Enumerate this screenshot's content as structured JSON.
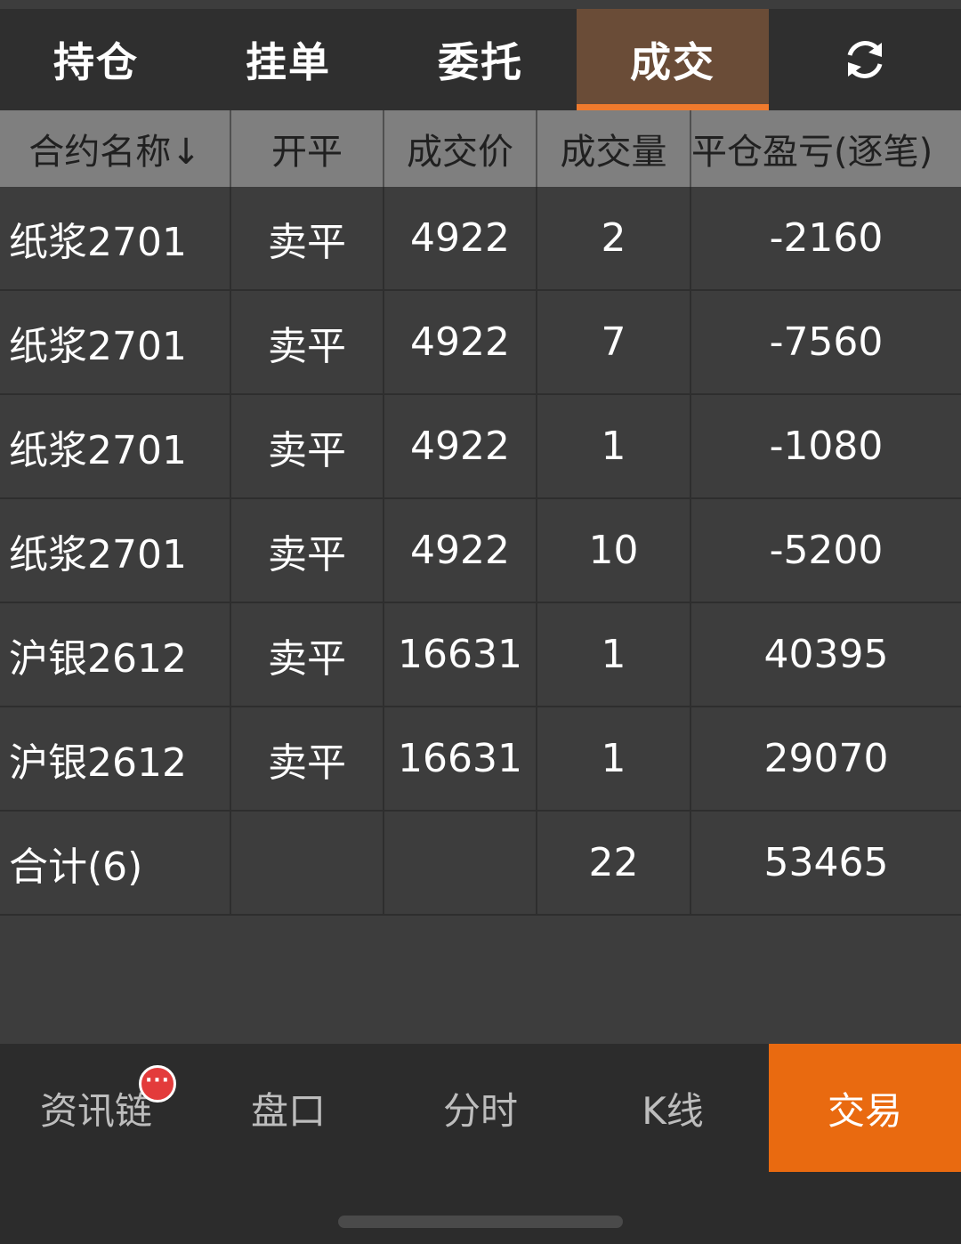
{
  "tabs": [
    {
      "label": "持仓"
    },
    {
      "label": "挂单"
    },
    {
      "label": "委托"
    },
    {
      "label": "成交"
    }
  ],
  "active_tab": "成交",
  "refresh_icon": "refresh-icon",
  "table": {
    "headers": [
      "合约名称↓",
      "开平",
      "成交价",
      "成交量",
      "平仓盈亏(逐笔)"
    ],
    "rows": [
      {
        "name": "纸浆2701",
        "open_close": "卖平",
        "price": "4922",
        "qty": "2",
        "pnl": "-2160"
      },
      {
        "name": "纸浆2701",
        "open_close": "卖平",
        "price": "4922",
        "qty": "7",
        "pnl": "-7560"
      },
      {
        "name": "纸浆2701",
        "open_close": "卖平",
        "price": "4922",
        "qty": "1",
        "pnl": "-1080"
      },
      {
        "name": "纸浆2701",
        "open_close": "卖平",
        "price": "4922",
        "qty": "10",
        "pnl": "-5200"
      },
      {
        "name": "沪银2612",
        "open_close": "卖平",
        "price": "16631",
        "qty": "1",
        "pnl": "40395"
      },
      {
        "name": "沪银2612",
        "open_close": "卖平",
        "price": "16631",
        "qty": "1",
        "pnl": "29070"
      }
    ],
    "total": {
      "label": "合计(6)",
      "qty": "22",
      "pnl": "53465"
    }
  },
  "bottom_nav": [
    {
      "label": "资讯链"
    },
    {
      "label": "盘口"
    },
    {
      "label": "分时"
    },
    {
      "label": "K线"
    },
    {
      "label": "交易"
    }
  ],
  "badge": "···",
  "colors": {
    "profit": "#e54848",
    "loss": "#2db84c",
    "accent": "#e96a10",
    "active_tab": "#6a4c37"
  }
}
